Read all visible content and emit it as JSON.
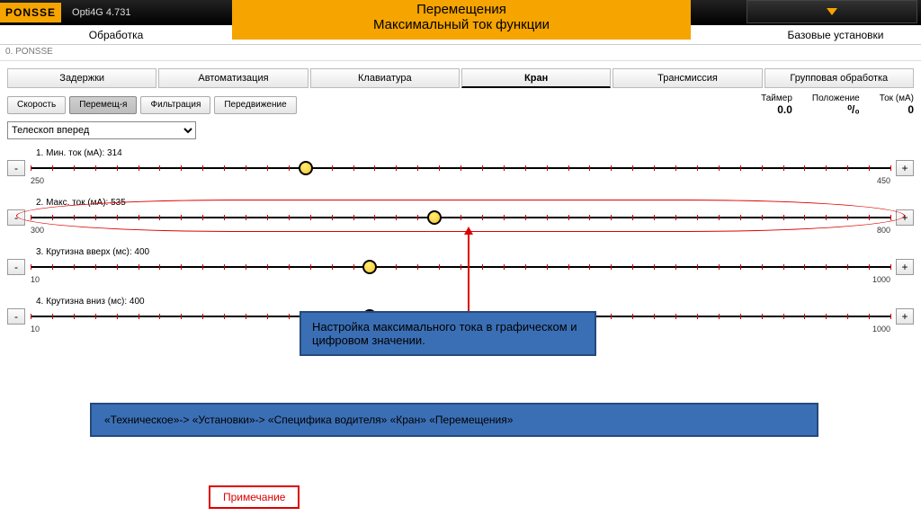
{
  "header": {
    "logo": "PONSSE",
    "version": "Opti4G 4.731",
    "title_line1": "Перемещения",
    "title_line2": "Максимальный ток функции"
  },
  "subbar": {
    "left": "Обработка",
    "right": "Базовые установки"
  },
  "breadcrumb": "0. PONSSE",
  "tabs": [
    "Задержки",
    "Автоматизация",
    "Клавиатура",
    "Кран",
    "Трансмиссия",
    "Групповая обработка"
  ],
  "active_tab_index": 3,
  "subtabs": [
    "Скорость",
    "Перемещ-я",
    "Фильтрация",
    "Передвижение"
  ],
  "active_subtab_index": 1,
  "readouts": {
    "timer_label": "Таймер",
    "timer_val": "0.0",
    "pos_label": "Положение",
    "pos_val": "⁰/₀",
    "cur_label": "Ток (мА)",
    "cur_val": "0"
  },
  "dropdown_value": "Телескоп вперед",
  "sliders": [
    {
      "label": "1. Мин. ток  (мА): 314",
      "lo": "250",
      "hi": "450",
      "pct": 32
    },
    {
      "label": "2. Макс. ток  (мА): 535",
      "lo": "300",
      "hi": "800",
      "pct": 47
    },
    {
      "label": "3. Крутизна вверх (мс): 400",
      "lo": "10",
      "hi": "1000",
      "pct": 39.4
    },
    {
      "label": "4. Крутизна вниз (мс): 400",
      "lo": "10",
      "hi": "1000",
      "pct": 39.4
    }
  ],
  "minus": "-",
  "plus": "+",
  "callouts": {
    "main": "Настройка максимального тока в графическом и цифровом значении.",
    "path": "«Техническое»-> «Установки»-> «Специфика водителя» «Кран» «Перемещения»",
    "note": "Примечание"
  }
}
